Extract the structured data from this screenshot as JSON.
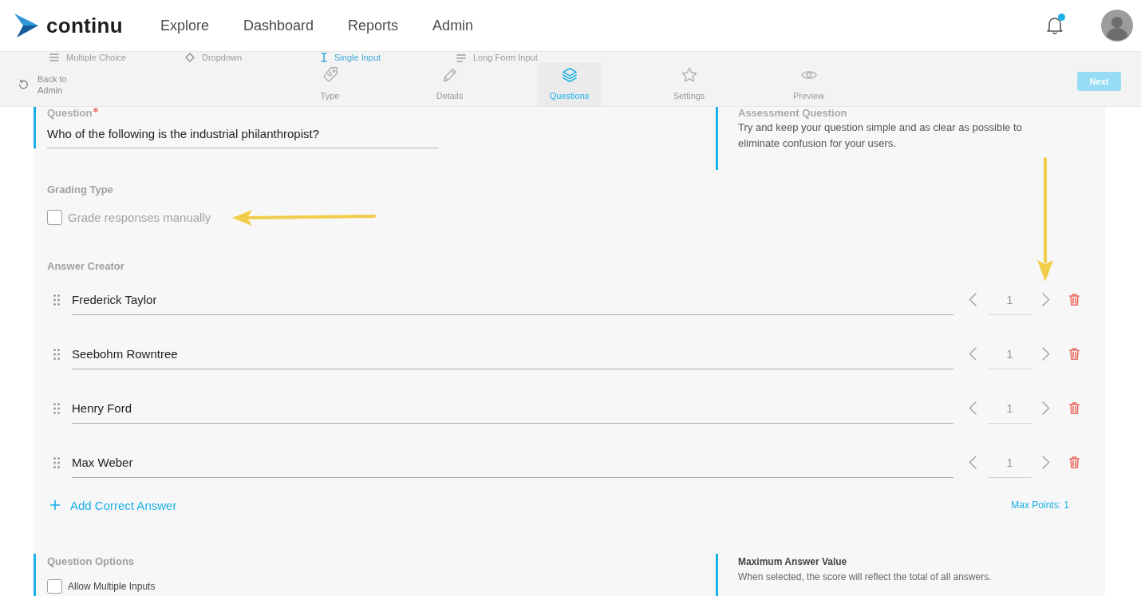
{
  "nav": {
    "logo": "continu",
    "links": [
      "Explore",
      "Dashboard",
      "Reports",
      "Admin"
    ],
    "notification": {
      "unread": true
    }
  },
  "question_types": [
    {
      "label": "Multiple Choice",
      "selected": false
    },
    {
      "label": "Dropdown",
      "selected": false
    },
    {
      "label": "Single Input",
      "selected": true
    },
    {
      "label": "Long Form Input",
      "selected": false
    }
  ],
  "wizard": {
    "back": "Back to Admin",
    "tabs": [
      {
        "label": "Type",
        "selected": false
      },
      {
        "label": "Details",
        "selected": false
      },
      {
        "label": "Questions",
        "selected": true
      },
      {
        "label": "Settings",
        "selected": false
      },
      {
        "label": "Preview",
        "selected": false
      }
    ],
    "next": {
      "label": "Next",
      "disabled": true
    }
  },
  "question": {
    "label": "Question",
    "required": true,
    "value": "Who of the following is the industrial philanthropist?",
    "hint": {
      "title": "Assessment Question",
      "text": "Try and keep your question simple and as clear as possible to eliminate confusion for your users."
    }
  },
  "grading": {
    "title": "Grading Type",
    "option": {
      "label": "Grade responses manually",
      "checked": false
    }
  },
  "answer_creator": {
    "title": "Answer Creator",
    "answers": [
      {
        "value": "Frederick Taylor",
        "points": "1"
      },
      {
        "value": "Seebohm Rowntree",
        "points": "1"
      },
      {
        "value": "Henry Ford",
        "points": "1"
      },
      {
        "value": "Max Weber",
        "points": "1"
      }
    ],
    "add_label": "Add Correct Answer",
    "max_points": "Max Points: 1"
  },
  "question_options": {
    "title": "Question Options",
    "options": [
      {
        "label": "Allow Multiple Inputs",
        "checked": false
      }
    ],
    "hint": {
      "title": "Maximum Answer Value",
      "text": "When selected, the score will reflect the total of all answers."
    }
  }
}
